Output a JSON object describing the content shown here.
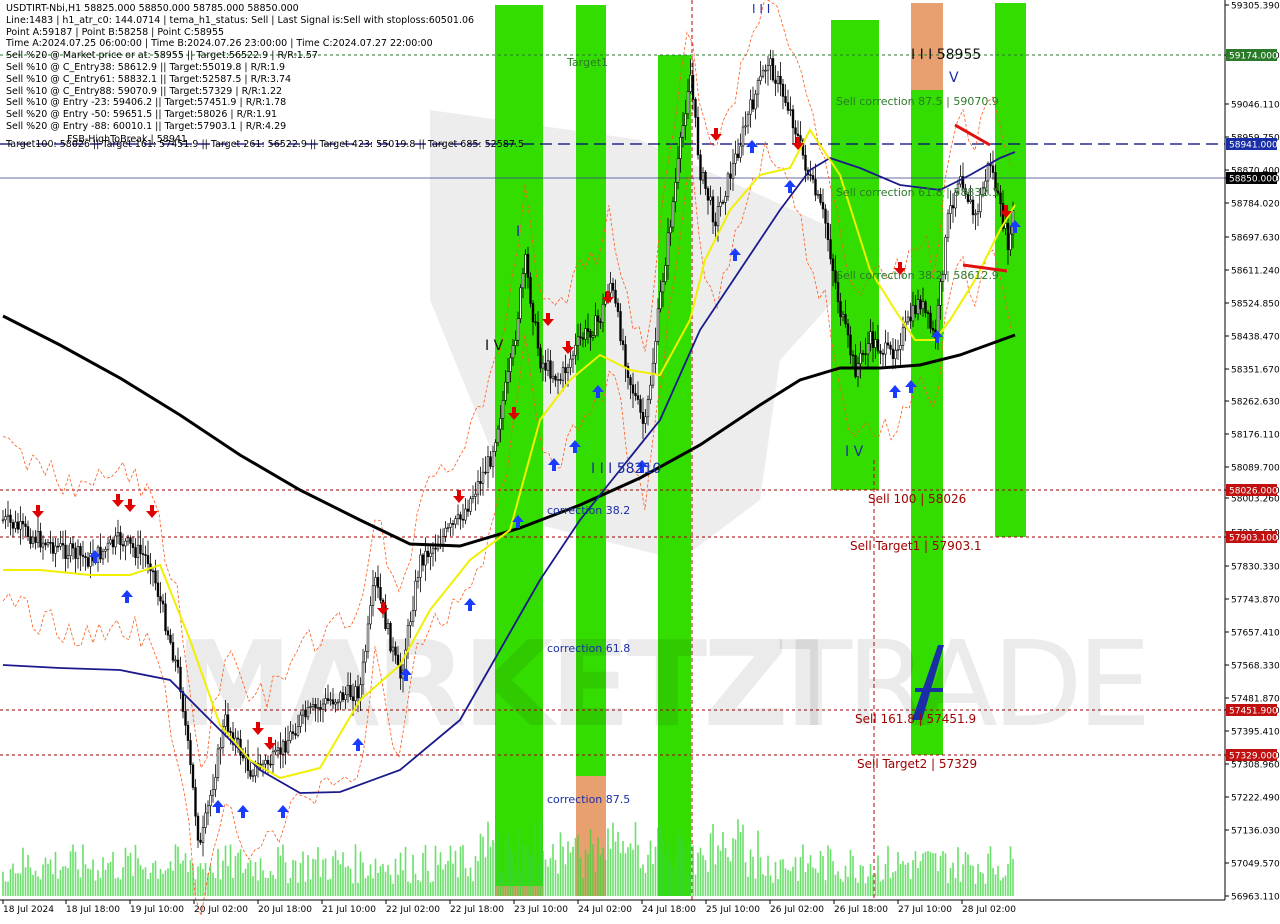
{
  "header": {
    "symbol_line": "USDTIRT-Nbi,H1  58825.000 58850.000 58785.000 58850.000",
    "info_lines": [
      "Line:1483 | h1_atr_c0: 144.0714 | tema_h1_status: Sell | Last Signal is:Sell with stoploss:60501.06",
      "Point A:59187 | Point B:58258 | Point C:58955",
      "Time A:2024.07.25 06:00:00 | Time B:2024.07.26 23:00:00 | Time C:2024.07.27 22:00:00",
      "Sell %20 @ Market price or at: 58955 || Target:56522.9 | R/R:1.57",
      "Sell %10 @ C_Entry38: 58612.9 || Target:55019.8 | R/R:1.9",
      "Sell %10 @ C_Entry61: 58832.1 || Target:52587.5 | R/R:3.74",
      "Sell %10 @ C_Entry88: 59070.9 || Target:57329 | R/R:1.22",
      "Sell %10 @ Entry -23: 59406.2 || Target:57451.9 | R/R:1.78",
      "Sell %20 @ Entry -50: 59651.5 || Target:58026 | R/R:1.91",
      "Sell %20 @ Entry -88: 60010.1 || Target:57903.1 | R/R:4.29"
    ],
    "targets_line": "Target100: 58026 || Target 161: 57451.9 || Target 261: 56522.9 || Target 423: 55019.8 || Target 685: 52587.5",
    "overlay_text": "FSB-HighToBreak | 58941"
  },
  "colors": {
    "accent_green": "#33dd00",
    "salmon": "#e9a070",
    "price_line": "#000080",
    "ma_black": "#000000",
    "ma_navy": "#1a1a8c",
    "ma_yellow": "#f0f000",
    "buy_arrow": "#1a3cff",
    "sell_arrow": "#e00000",
    "level_dashed": "#a00000",
    "target_green_line": "#2a7a2a"
  },
  "price_axis": {
    "ticks": [
      "59305.390",
      "59174.000",
      "59046.110",
      "58959.750",
      "58870.400",
      "58850.000",
      "58784.020",
      "58697.630",
      "58611.240",
      "58524.850",
      "58438.470",
      "58351.670",
      "58262.630",
      "58176.110",
      "58089.700",
      "58026.000",
      "58003.260",
      "57916.610",
      "57903.100",
      "57830.330",
      "57743.870",
      "57657.410",
      "57568.330",
      "57481.870",
      "57451.900",
      "57395.410",
      "57329.000",
      "57308.960",
      "57222.490",
      "57136.030",
      "57049.570",
      "56963.110"
    ],
    "tags": [
      {
        "label": "59174.000",
        "kind": "green"
      },
      {
        "label": "58941.000",
        "kind": "blue"
      },
      {
        "label": "58850.000",
        "kind": "black"
      },
      {
        "label": "58026.000",
        "kind": "red"
      },
      {
        "label": "57903.100",
        "kind": "red"
      },
      {
        "label": "57451.900",
        "kind": "red"
      },
      {
        "label": "57329.000",
        "kind": "red"
      }
    ]
  },
  "time_axis": {
    "labels": [
      "18 Jul 2024",
      "18 Jul 18:00",
      "19 Jul 10:00",
      "20 Jul 02:00",
      "20 Jul 18:00",
      "21 Jul 10:00",
      "22 Jul 02:00",
      "22 Jul 18:00",
      "23 Jul 10:00",
      "24 Jul 02:00",
      "24 Jul 18:00",
      "25 Jul 10:00",
      "26 Jul 02:00",
      "26 Jul 18:00",
      "27 Jul 10:00",
      "28 Jul 02:00"
    ]
  },
  "annotations": {
    "target1": "Target1",
    "wave_iii_top": "I I I",
    "wave_iii_58955": "I I I 58955",
    "wave_v": "V",
    "wave_i": "I",
    "wave_iv_left": "I V",
    "wave_iii_58210": "I I I 58210",
    "wave_iv_right": "I V",
    "sell_corr_875": "Sell correction 87.5 | 59070.9",
    "sell_corr_618": "Sell correction 61.8 | 58832.1",
    "sell_corr_382": "Sell correction 38.2 | 58612.9",
    "correction_382": "correction 38.2",
    "correction_618": "correction 61.8",
    "correction_875": "correction 87.5",
    "sell_100": "Sell 100 | 58026",
    "sell_target1": "Sell Target1 | 57903.1",
    "sell_1618": "Sell 161.8 | 57451.9",
    "sell_target2": "Sell Target2 | 57329"
  },
  "watermark": {
    "part1": "MARKETZI",
    "part2": "TRADE"
  }
}
